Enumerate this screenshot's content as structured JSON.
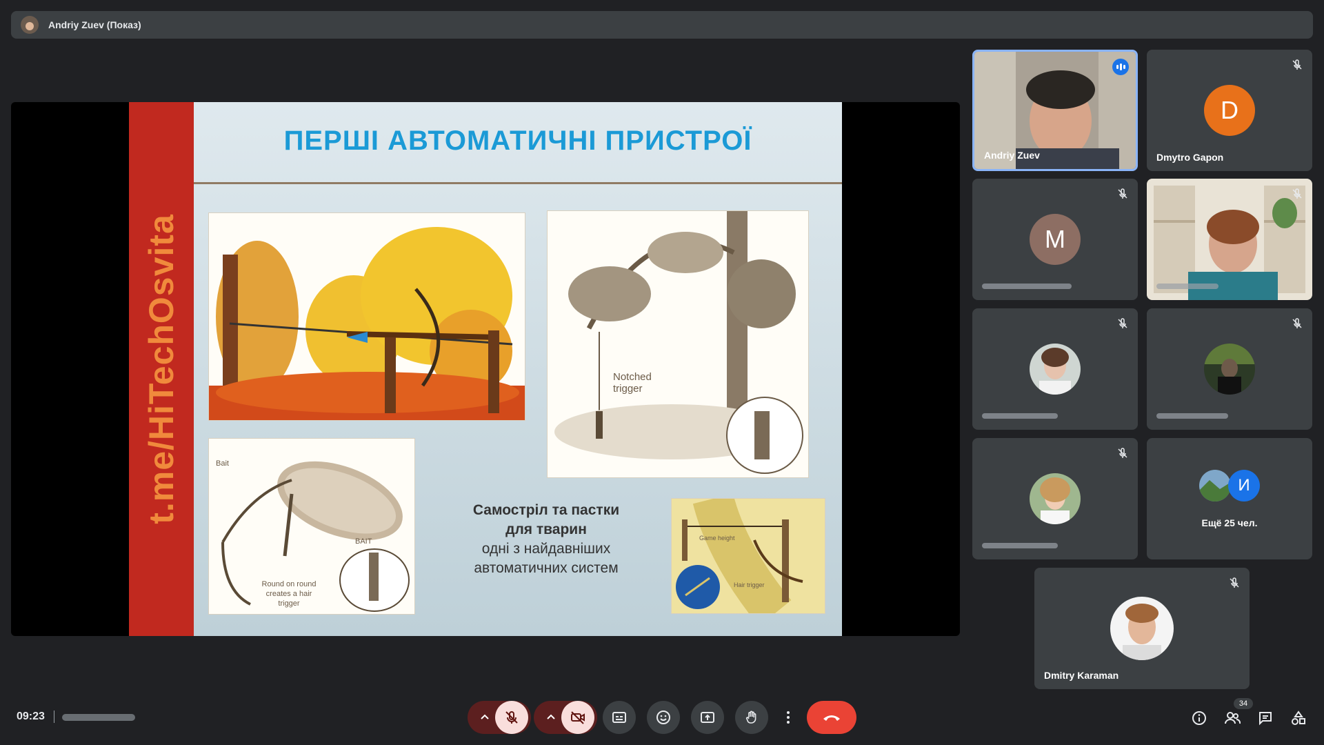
{
  "presenter_bar": {
    "label": "Andriy Zuev (Показ)"
  },
  "slide": {
    "side_text": "t.me/HiTechOsvita",
    "title": "ПЕРШІ АВТОМАТИЧНІ ПРИСТРОЇ",
    "caption_line1": "Самостріл та пастки",
    "caption_line2": "для тварин",
    "caption_line3": "одні з найдавніших",
    "caption_line4": "автоматичних систем",
    "image_labels": {
      "notched": "Notched trigger",
      "bait1": "Bait",
      "bait2": "BAIT",
      "round": "Round on round creates a hair trigger",
      "game_height": "Game height",
      "hair_trigger": "Hair trigger"
    }
  },
  "participants": [
    {
      "name": "Andriy Zuev",
      "type": "video",
      "speaking": true
    },
    {
      "name": "Dmytro Gapon",
      "type": "letter",
      "letter": "D",
      "color": "#e8711a",
      "muted": true
    },
    {
      "name": "",
      "type": "letter",
      "letter": "M",
      "color": "#8d6e63",
      "muted": true,
      "name_hidden": true
    },
    {
      "name": "",
      "type": "video",
      "muted": true,
      "name_hidden": true
    },
    {
      "name": "",
      "type": "photo",
      "muted": true,
      "name_hidden": true
    },
    {
      "name": "",
      "type": "photo",
      "muted": true,
      "name_hidden": true
    },
    {
      "name": "",
      "type": "photo",
      "muted": true,
      "name_hidden": true
    },
    {
      "name": "Ещё 25 чел.",
      "type": "overflow",
      "letter": "И",
      "color": "#1a73e8"
    },
    {
      "name": "Dmitry Karaman",
      "type": "photo",
      "muted": true
    }
  ],
  "bottom_bar": {
    "time": "09:23",
    "participants_count": "34"
  },
  "icons": {
    "mic": "mic-off-icon",
    "camera": "camera-off-icon",
    "captions": "captions-icon",
    "emoji": "emoji-icon",
    "present": "present-icon",
    "hand": "raise-hand-icon",
    "more": "more-vert-icon",
    "end": "end-call-icon",
    "info": "info-icon",
    "people": "people-icon",
    "chat": "chat-icon",
    "activities": "activities-icon"
  },
  "colors": {
    "accent": "#8ab4f8",
    "end_call": "#ea4335",
    "mute_bg": "#f9dedc"
  }
}
